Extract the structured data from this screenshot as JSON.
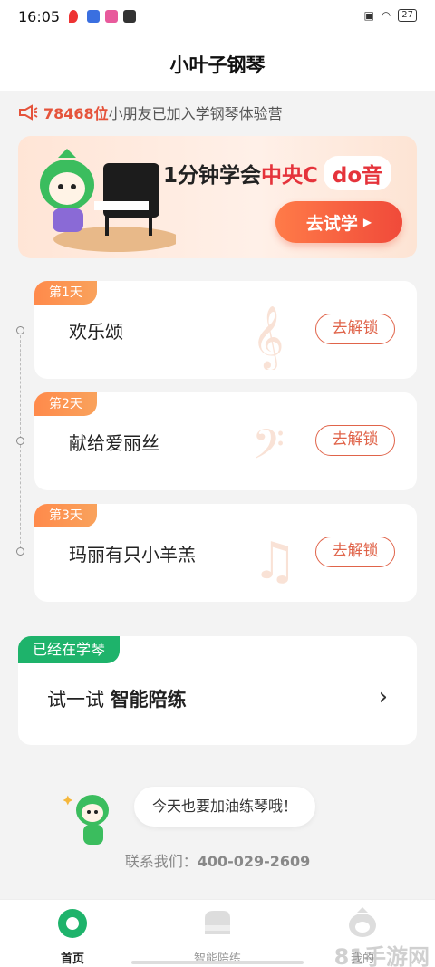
{
  "status_bar": {
    "time": "16:05",
    "battery": "27"
  },
  "header": {
    "title": "小叶子钢琴"
  },
  "notice": {
    "count": "78468位",
    "text": "小朋友已加入学钢琴体验营"
  },
  "banner": {
    "prefix": "1分钟学会",
    "highlight": "中央C",
    "pill": "do音",
    "button": "去试学"
  },
  "days": [
    {
      "tag": "第1天",
      "song": "欢乐颂",
      "button": "去解锁"
    },
    {
      "tag": "第2天",
      "song": "献给爱丽丝",
      "button": "去解锁"
    },
    {
      "tag": "第3天",
      "song": "玛丽有只小羊羔",
      "button": "去解锁"
    }
  ],
  "practice": {
    "tag": "已经在学琴",
    "prefix": "试一试",
    "bold": "智能陪练"
  },
  "cheer": {
    "bubble": "今天也要加油练琴哦！"
  },
  "contact": {
    "label": "联系我们：",
    "phone": "400-029-2609"
  },
  "tabs": [
    {
      "label": "首页",
      "icon": "home-leaf-icon"
    },
    {
      "label": "智能陪练",
      "icon": "piano-icon"
    },
    {
      "label": "我的",
      "icon": "profile-leaf-icon"
    }
  ],
  "watermark": "81手游网",
  "colors": {
    "accent_red": "#e5333b",
    "orange": "#ff7b48",
    "green": "#1eb36b"
  }
}
